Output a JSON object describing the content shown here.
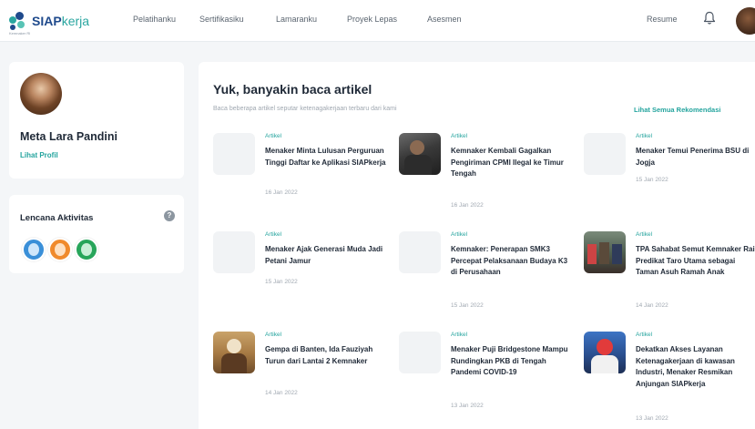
{
  "header": {
    "logo": {
      "siap": "SIAP",
      "kerja": "kerja",
      "tagline": "Kemnaker RI"
    },
    "nav": [
      {
        "label": "Pelatihanku"
      },
      {
        "label": "Sertifikasiku"
      },
      {
        "label": "Lamaranku"
      },
      {
        "label": "Proyek Lepas"
      },
      {
        "label": "Asesmen"
      }
    ],
    "resume_label": "Resume"
  },
  "profile": {
    "name": "Meta Lara Pandini",
    "link_label": "Lihat Profil"
  },
  "badges": {
    "title": "Lencana Aktivitas",
    "help_glyph": "?",
    "items": [
      {
        "name": "badge-blue",
        "color": "#3a8fd8"
      },
      {
        "name": "badge-orange",
        "color": "#f08a2c"
      },
      {
        "name": "badge-green",
        "color": "#27a55a"
      }
    ]
  },
  "main": {
    "title": "Yuk, banyakin baca artikel",
    "subtitle": "Baca beberapa artikel seputar ketenagakerjaan terbaru dari kami",
    "see_all_label": "Lihat Semua Rekomendasi",
    "articles": [
      {
        "category": "Artikel",
        "title": "Menaker Minta Lulusan Perguruan Tinggi Daftar ke Aplikasi SIAPkerja",
        "date": "16 Jan 2022"
      },
      {
        "category": "Artikel",
        "title": "Kemnaker Kembali Gagalkan Pengiriman CPMI Ilegal ke Timur Tengah",
        "date": "16 Jan 2022"
      },
      {
        "category": "Artikel",
        "title": "Menaker Temui Penerima BSU di Jogja",
        "date": "15 Jan 2022"
      },
      {
        "category": "Artikel",
        "title": "Menaker Ajak Generasi Muda Jadi Petani Jamur",
        "date": "15 Jan 2022"
      },
      {
        "category": "Artikel",
        "title": "Kemnaker: Penerapan SMK3 Percepat Pelaksanaan Budaya K3 di Perusahaan",
        "date": "15 Jan 2022"
      },
      {
        "category": "Artikel",
        "title": "TPA Sahabat Semut Kemnaker Raih Predikat Taro Utama sebagai Taman Asuh Ramah Anak",
        "date": "14 Jan 2022"
      },
      {
        "category": "Artikel",
        "title": "Gempa di Banten, Ida Fauziyah Turun dari Lantai 2 Kemnaker",
        "date": "14 Jan 2022"
      },
      {
        "category": "Artikel",
        "title": "Menaker Puji Bridgestone Mampu Rundingkan PKB di Tengah Pandemi COVID-19",
        "date": "13 Jan 2022"
      },
      {
        "category": "Artikel",
        "title": "Dekatkan Akses Layanan Ketenagakerjaan di kawasan Industri, Menaker Resmikan Anjungan SIAPkerja",
        "date": "13 Jan 2022"
      }
    ]
  }
}
